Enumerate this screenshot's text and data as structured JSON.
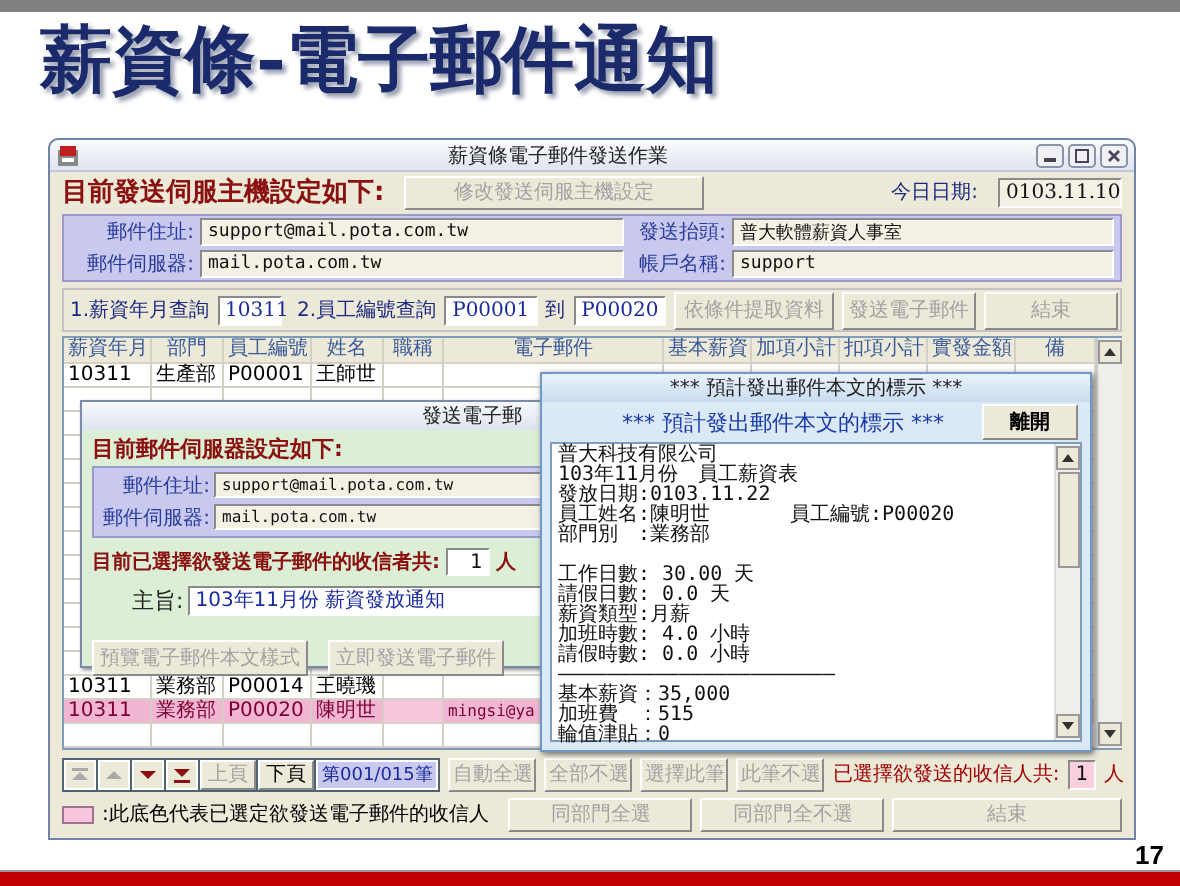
{
  "slide": {
    "title": "薪資條-電子郵件通知",
    "page_number": "17"
  },
  "window": {
    "title": "薪資條電子郵件發送作業",
    "server_heading": "目前發送伺服主機設定如下:",
    "modify_button": {
      "label": "修改發送伺服主機設定",
      "disabled": true
    },
    "date_label": "今日日期:",
    "date_value": "0103.11.10",
    "settings": [
      {
        "label": "郵件住址:",
        "value": "support@mail.pota.com.tw"
      },
      {
        "label": "發送抬頭:",
        "value": "普大軟體薪資人事室"
      },
      {
        "label": "郵件伺服器:",
        "value": "mail.pota.com.tw"
      },
      {
        "label": "帳戶名稱:",
        "value": "support"
      }
    ],
    "query": {
      "month_label": "1.薪資年月查詢",
      "month_value": "10311",
      "employee_label": "2.員工編號查詢",
      "employee_from": "P00001",
      "to_label": "到",
      "employee_to": "P00020"
    },
    "query_buttons": [
      {
        "label": "依條件提取資料",
        "disabled": true
      },
      {
        "label": "發送電子郵件",
        "disabled": true
      },
      {
        "label": "結束",
        "disabled": true
      }
    ],
    "table": {
      "columns": [
        "薪資年月",
        "部門",
        "員工編號",
        "姓名",
        "職稱",
        "電子郵件",
        "基本薪資",
        "加項小計",
        "扣項小計",
        "實發金額",
        "備"
      ],
      "rows": [
        {
          "salary_month": "10311",
          "department": "生產部",
          "employee_id": "P00001",
          "name": "王師世",
          "selected": false
        },
        {
          "salary_month": "10311",
          "department": "業務部",
          "employee_id": "P00014",
          "name": "王曉璣",
          "selected": false
        },
        {
          "salary_month": "10311",
          "department": "業務部",
          "employee_id": "P00020",
          "name": "陳明世",
          "email": "mingsi@ya",
          "selected": true
        }
      ]
    },
    "nav_buttons": [
      {
        "label": "上頁",
        "disabled": true
      },
      {
        "label": "下頁",
        "disabled": false
      }
    ],
    "record_counter": "第001/015筆",
    "selection_buttons": [
      {
        "label": "自動全選",
        "disabled": true
      },
      {
        "label": "全部不選",
        "disabled": true
      },
      {
        "label": "選擇此筆",
        "disabled": true
      },
      {
        "label": "此筆不選",
        "disabled": true
      }
    ],
    "selected_count_label": "已選擇欲發送的收信人共:",
    "selected_count": "1",
    "selected_count_unit": "人",
    "legend_text": ":此底色代表已選定欲發送電子郵件的收信人",
    "department_buttons": [
      {
        "label": "同部門全選",
        "disabled": true
      },
      {
        "label": "同部門全不選",
        "disabled": true
      }
    ],
    "exit_button": {
      "label": "結束",
      "disabled": true
    }
  },
  "send_dialog": {
    "title": "發送電子郵",
    "heading": "目前郵件伺服器設定如下:",
    "settings": [
      {
        "label": "郵件住址:",
        "value": "support@mail.pota.com.tw"
      },
      {
        "label": "郵件伺服器:",
        "value": "mail.pota.com.tw"
      }
    ],
    "recipient_label": "目前已選擇欲發送電子郵件的收信者共:",
    "recipient_count": "1",
    "recipient_unit": "人",
    "subject_label": "主旨:",
    "subject_value": "103年11月份 薪資發放通知",
    "buttons": [
      {
        "label": "預覽電子郵件本文樣式",
        "disabled": true
      },
      {
        "label": "立即發送電子郵件",
        "disabled": true
      }
    ]
  },
  "preview_dialog": {
    "title": "*** 預計發出郵件本文的標示 ***",
    "heading": "*** 預計發出郵件本文的標示 ***",
    "close_button": "離開",
    "body_blocks": [
      [
        "普大科技有限公司",
        "103年11月份　員工薪資表",
        "發放日期:0103.11.22",
        "員工姓名:陳明世　　　　員工編號:P00020",
        "部門別　:業務部"
      ],
      [
        "工作日數: 30.00 天",
        "請假日數: 0.0 天",
        "薪資類型:月薪",
        "加班時數: 4.0 小時",
        "請假時數: 0.0 小時",
        "———————————————————————",
        "基本薪資：35,000",
        "加班費　：515",
        "輪值津貼：0"
      ]
    ]
  }
}
